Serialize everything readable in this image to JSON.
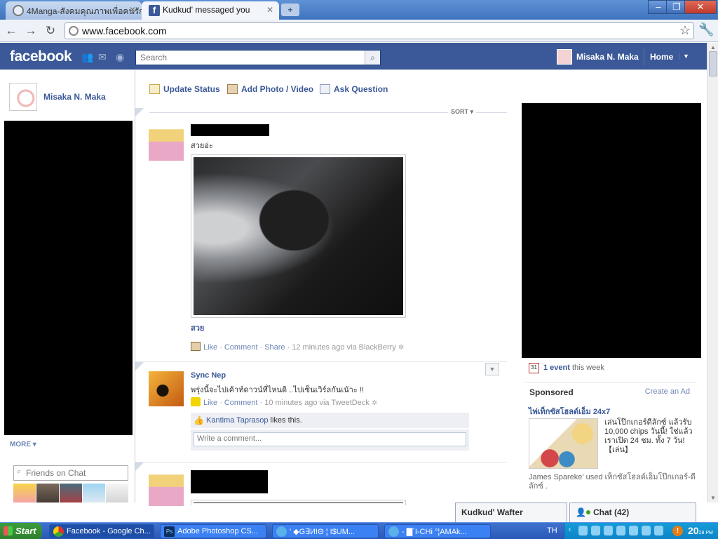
{
  "browser": {
    "tabs": [
      {
        "title": "4Manga-สังคมคุณภาพเพื่อคนรัก"
      },
      {
        "title": "Kudkud' messaged you"
      }
    ],
    "url": "www.facebook.com"
  },
  "header": {
    "logo": "facebook",
    "search_placeholder": "Search",
    "user_name": "Misaka N. Maka",
    "home_label": "Home"
  },
  "left": {
    "profile_name": "Misaka N. Maka",
    "more_label": "MORE ▾",
    "chat_search_placeholder": "Friends on Chat"
  },
  "composer": {
    "update_status": "Update Status",
    "add_photo": "Add Photo / Video",
    "ask_question": "Ask Question"
  },
  "feed": {
    "sort_label": "SORT ▾",
    "stories": [
      {
        "text": "สวยอ่ะ",
        "caption": "สวย",
        "like": "Like",
        "comment": "Comment",
        "share": "Share",
        "meta": "12 minutes ago via BlackBerry"
      },
      {
        "name": "Sync Nep",
        "text": "พรุ่งนี้จะไปเค้าท์ดาวน์ที่ไหนดิ ..ไปเซ็นเวิร์ลกันเน้าะ !!",
        "like": "Like",
        "comment": "Comment",
        "meta": "10 minutes ago via TweetDeck",
        "liker": "Kantima Taprasop",
        "likes_suffix": "likes this.",
        "comment_placeholder": "Write a comment..."
      }
    ]
  },
  "right": {
    "events_link": "1 event",
    "events_suffix": "this week",
    "calendar_day": "31",
    "sponsored_title": "Sponsored",
    "create_ad": "Create an Ad",
    "ad": {
      "title": "ไพ่เท็กซัสโฮลด์เอ็ม 24x7",
      "body": "เล่นโป๊กเกอร์ดีลักซ์ แล้วรับ 10,000 chips วันนี้! ใช่แล้ว เราเปิด 24 ชม. ทั้ง 7 วัน! 【เล่น】",
      "social": "James Spareke' used เท็กซัสโฮลด์เอ็มโป๊กเกอร์-ดีลักซ์ ."
    }
  },
  "chat_dock": {
    "conversation": "Kudkud' Wafter",
    "chat_label": "Chat (42)"
  },
  "taskbar": {
    "start": "Start",
    "tasks": [
      "Facebook - Google Ch...",
      "Adobe Photoshop CS...",
      "' ◆G∃И!Θ ¦ I$UM...",
      "- ▇`I-CHi °¦AMAk..."
    ],
    "lang": "TH",
    "clock": "20",
    "clock_min": "28",
    "clock_ampm": "PM"
  },
  "colors": {
    "facebook_blue": "#3b5998",
    "link_blue": "#3b5998",
    "taskbar_blue": "#2a58b8"
  }
}
